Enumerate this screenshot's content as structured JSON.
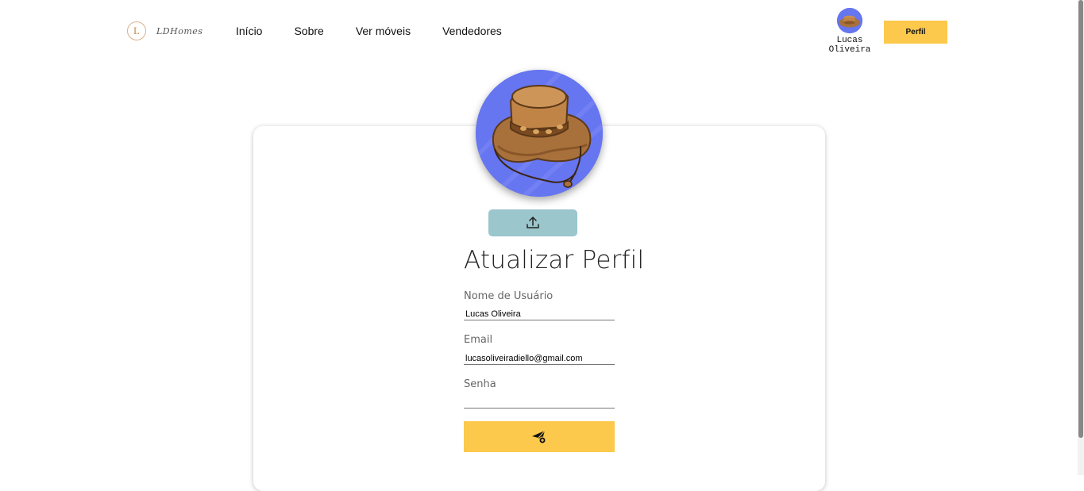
{
  "header": {
    "logo_letter": "L",
    "logo_text": "LDHomes",
    "nav": [
      {
        "label": "Início"
      },
      {
        "label": "Sobre"
      },
      {
        "label": "Ver móveis"
      },
      {
        "label": "Vendedores"
      }
    ],
    "user": {
      "first_name": "Lucas",
      "last_name": "Oliveira",
      "avatar_icon": "cowboy-hat-avatar"
    },
    "profile_button": "Perfil"
  },
  "profile_form": {
    "avatar_icon": "cowboy-hat-avatar",
    "upload_icon": "upload-icon",
    "title": "Atualizar Perfil",
    "username": {
      "label": "Nome de Usuário",
      "value": "Lucas Oliveira"
    },
    "email": {
      "label": "Email",
      "value": "lucasoliveiradiello@gmail.com"
    },
    "password": {
      "label": "Senha",
      "value": ""
    },
    "submit_icon": "send-icon"
  },
  "colors": {
    "accent_yellow": "#fcc94c",
    "upload_teal": "#9ac6cc",
    "avatar_bg": "#6675f0"
  }
}
